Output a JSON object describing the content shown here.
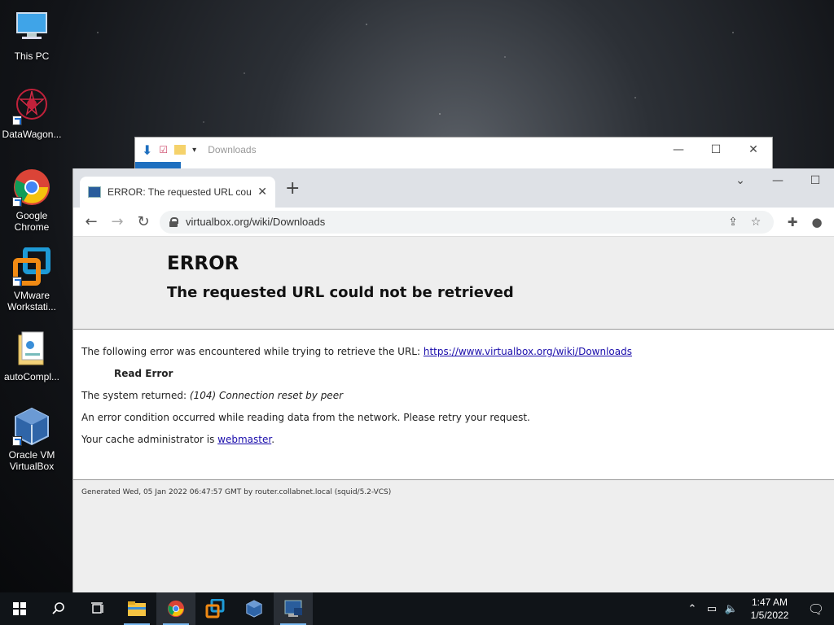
{
  "desktop": {
    "icons": [
      {
        "label": "This PC"
      },
      {
        "label": "DataWagon..."
      },
      {
        "label": "Google Chrome"
      },
      {
        "label": "VMware Workstati..."
      },
      {
        "label": "autoCompl..."
      },
      {
        "label": "Oracle VM VirtualBox"
      }
    ]
  },
  "explorer": {
    "title": "Downloads"
  },
  "browser": {
    "tab_title": "ERROR: The requested URL could",
    "url": "virtualbox.org/wiki/Downloads"
  },
  "error_page": {
    "heading": "ERROR",
    "subheading": "The requested URL could not be retrieved",
    "line1_prefix": "The following error was encountered while trying to retrieve the URL: ",
    "line1_link": "https://www.virtualbox.org/wiki/Downloads",
    "read_error": "Read Error",
    "line3_prefix": "The system returned: ",
    "line3_emph": "(104) Connection reset by peer",
    "line4": "An error condition occurred while reading data from the network. Please retry your request.",
    "line5_prefix": "Your cache administrator is ",
    "line5_link": "webmaster",
    "line5_suffix": ".",
    "footer": "Generated Wed, 05 Jan 2022 06:47:57 GMT by router.collabnet.local (squid/5.2-VCS)"
  },
  "taskbar": {
    "time": "1:47 AM",
    "date": "1/5/2022"
  }
}
